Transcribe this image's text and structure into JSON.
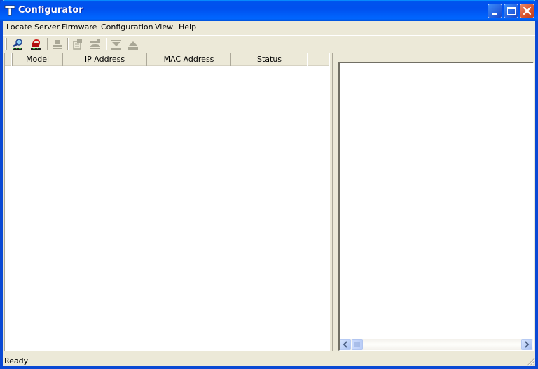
{
  "window": {
    "title": "Configurator",
    "app_icon": "hammer-icon",
    "controls": [
      "minimize-icon",
      "maximize-icon",
      "close-icon"
    ]
  },
  "menubar": {
    "items": [
      {
        "label": "Locate Server"
      },
      {
        "label": "Firmware"
      },
      {
        "label": "Configuration"
      },
      {
        "label": "View"
      },
      {
        "label": "Help"
      }
    ]
  },
  "toolbar": {
    "buttons": [
      {
        "icon": "search-server-icon",
        "tooltip": "Search",
        "enabled": true
      },
      {
        "icon": "locate-server-red-icon",
        "tooltip": "Locate",
        "enabled": true
      },
      {
        "icon": "server-settings-icon",
        "tooltip": "",
        "enabled": false
      },
      {
        "icon": "config-document-icon",
        "tooltip": "",
        "enabled": false
      },
      {
        "icon": "server-key-icon",
        "tooltip": "",
        "enabled": false
      },
      {
        "icon": "download-icon",
        "tooltip": "",
        "enabled": false
      },
      {
        "icon": "upload-icon",
        "tooltip": "",
        "enabled": false
      }
    ]
  },
  "server_list": {
    "columns": [
      "",
      "Model",
      "IP Address",
      "MAC Address",
      "Status",
      ""
    ],
    "rows": []
  },
  "statusbar": {
    "text": "Ready"
  },
  "colors": {
    "titlebar": "#0054E3",
    "chrome": "#ECE9D8",
    "close_button": "#D8532D"
  }
}
